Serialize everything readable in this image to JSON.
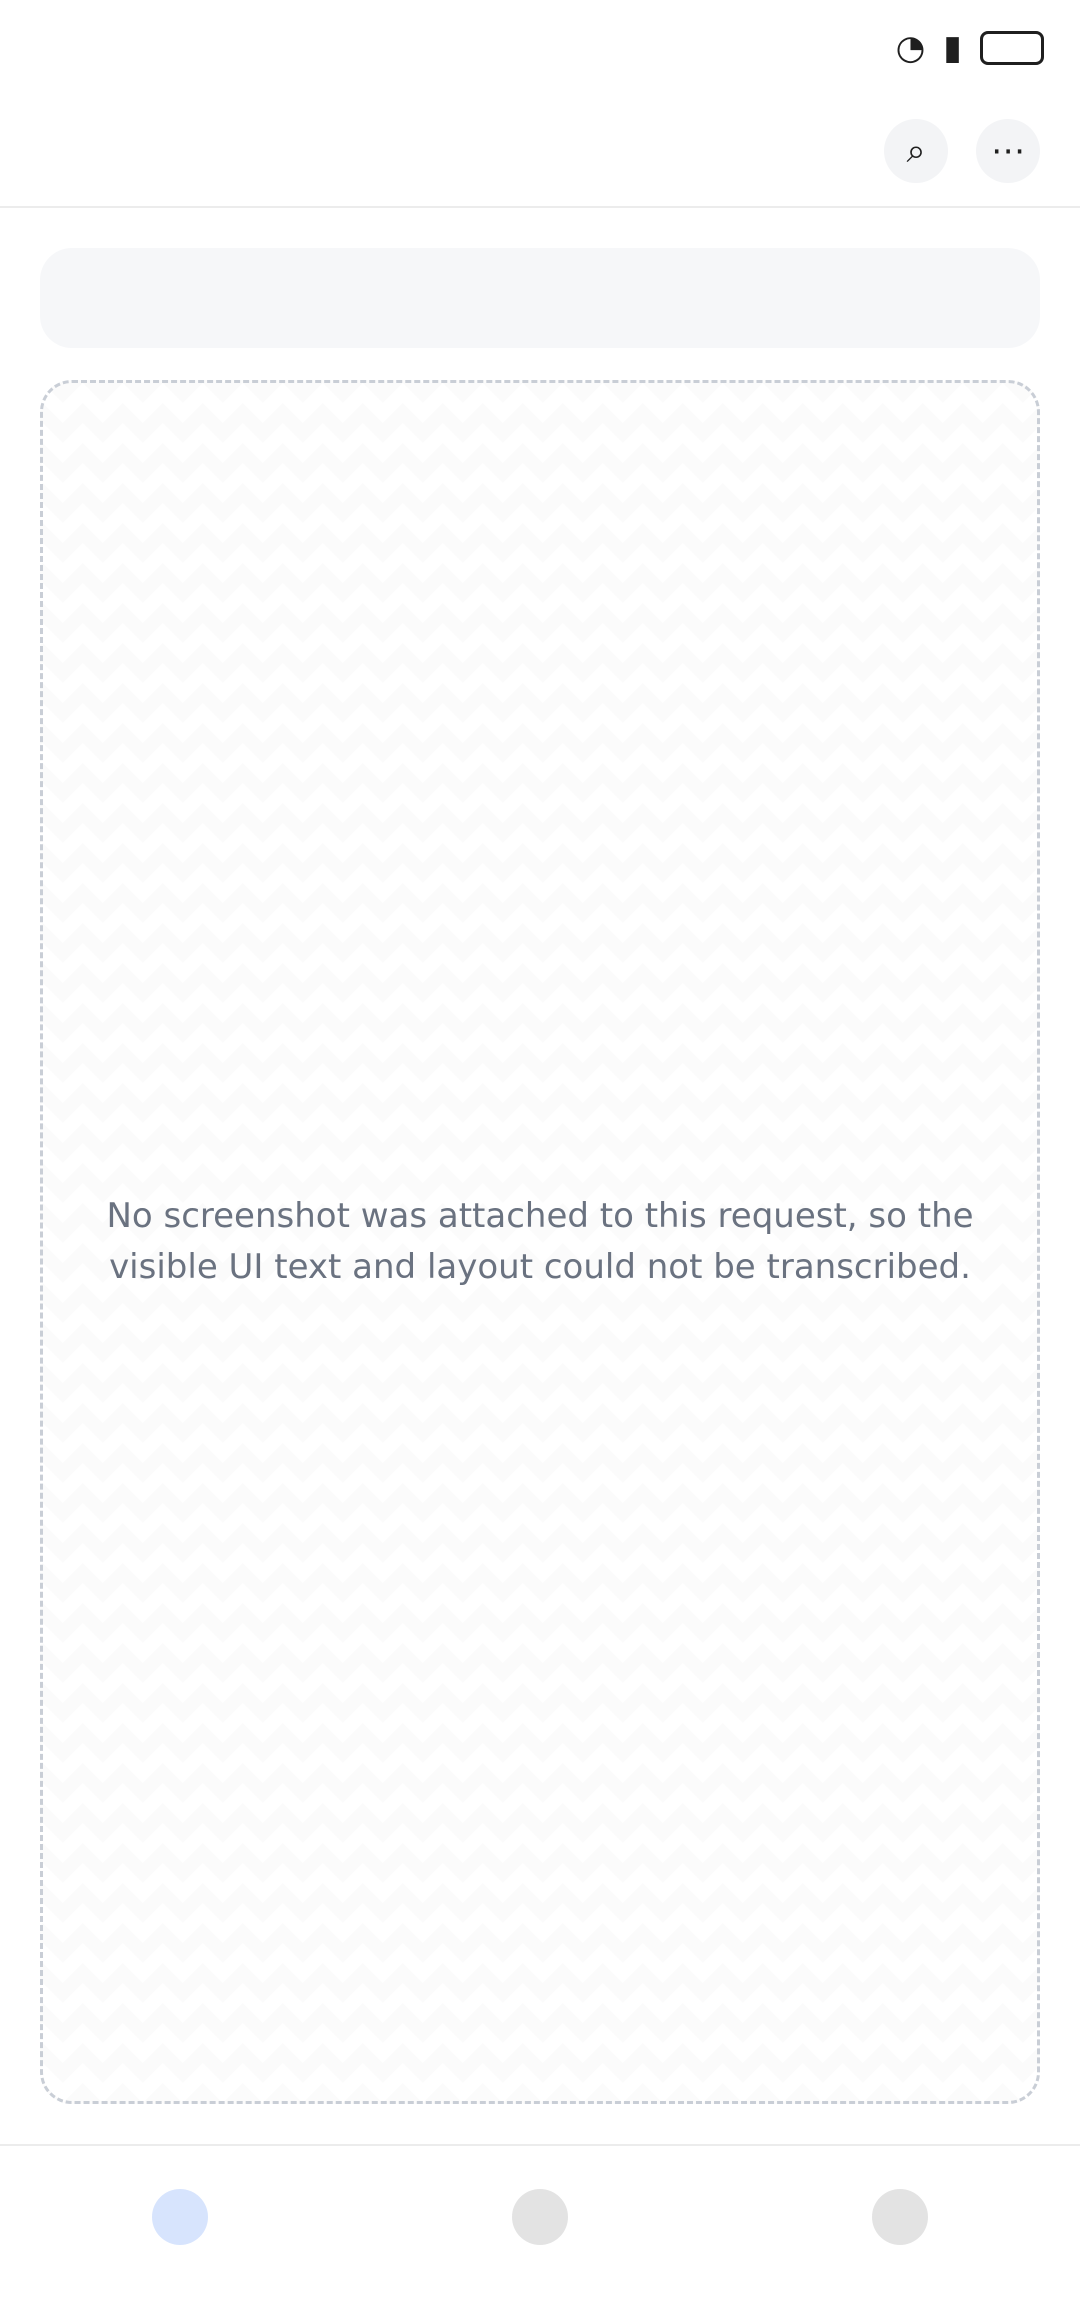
{
  "status_bar": {
    "time": "",
    "battery": ""
  },
  "header": {
    "title": ""
  },
  "notice": {
    "title": "",
    "body": ""
  },
  "placeholder": {
    "message": "No screenshot was attached to this request, so the visible UI text and layout could not be transcribed."
  },
  "bottom_nav": {
    "items": [
      {
        "label": ""
      },
      {
        "label": ""
      },
      {
        "label": ""
      }
    ]
  }
}
